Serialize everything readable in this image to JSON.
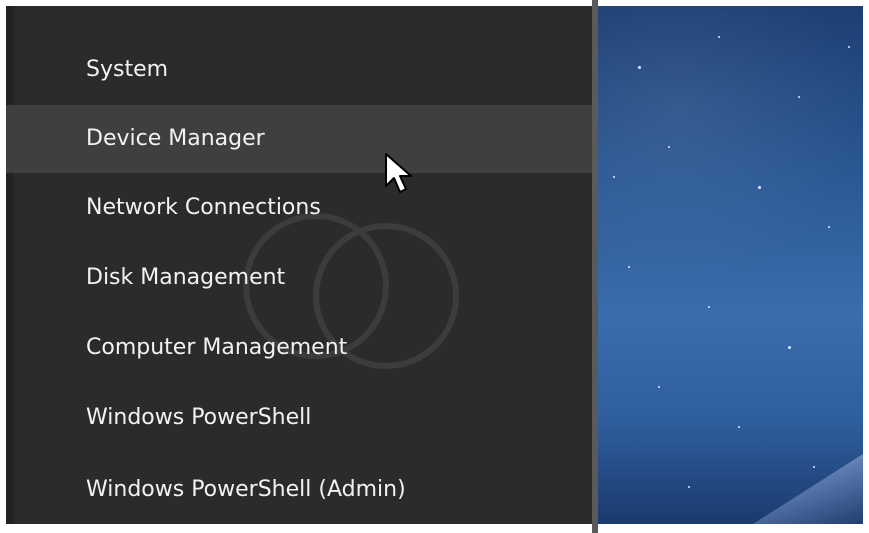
{
  "winx_menu": {
    "items": [
      {
        "label": "System",
        "hovered": false
      },
      {
        "label": "Device Manager",
        "hovered": true
      },
      {
        "label": "Network Connections",
        "hovered": false
      },
      {
        "label": "Disk Management",
        "hovered": false
      },
      {
        "label": "Computer Management",
        "hovered": false
      },
      {
        "label": "Windows PowerShell",
        "hovered": false
      },
      {
        "label": "Windows PowerShell (Admin)",
        "hovered": false
      }
    ]
  },
  "colors": {
    "menu_background": "#2b2b2b",
    "hover_background": "#3f3f3f",
    "text": "#f2f2f2",
    "wallpaper": "#2c5a96"
  },
  "icons": {
    "pointer": "mouse-pointer-icon"
  }
}
